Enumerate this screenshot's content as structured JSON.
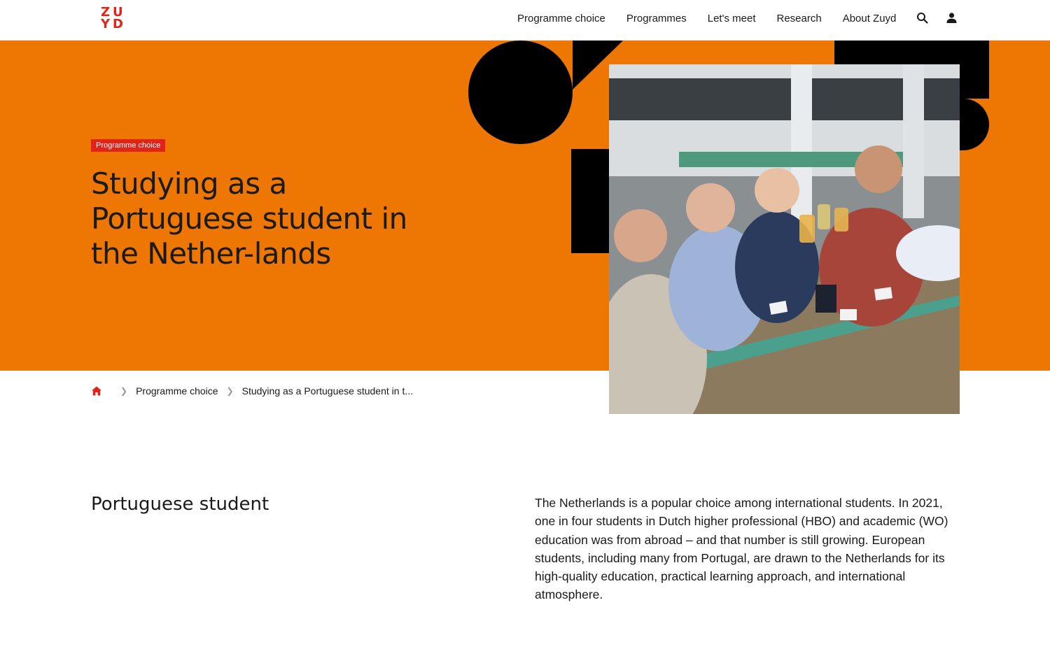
{
  "brand": {
    "logo_line1": "ZU",
    "logo_line2": "YD",
    "accent": "#e2231a",
    "hero_color": "#ee7703"
  },
  "nav": {
    "items": [
      {
        "label": "Programme choice"
      },
      {
        "label": "Programmes"
      },
      {
        "label": "Let's meet"
      },
      {
        "label": "Research"
      },
      {
        "label": "About Zuyd"
      }
    ],
    "search_icon": "search-icon",
    "user_icon": "user-icon"
  },
  "hero": {
    "tag": "Programme choice",
    "title": "Studying as a Portuguese student in the Nether-lands"
  },
  "breadcrumb": {
    "home_icon": "home-icon",
    "items": [
      {
        "label": "Programme choice"
      },
      {
        "label": "Studying as a Portuguese student in t..."
      }
    ]
  },
  "content": {
    "heading": "Portuguese student",
    "paragraph": "The Netherlands is a popular choice among international students. In 2021, one in four students in Dutch higher professional (HBO) and academic (WO) education was from abroad – and that number is still growing. European students, including many from Portugal, are drawn to the Netherlands for its high-quality education, practical learning approach, and international atmosphere."
  }
}
